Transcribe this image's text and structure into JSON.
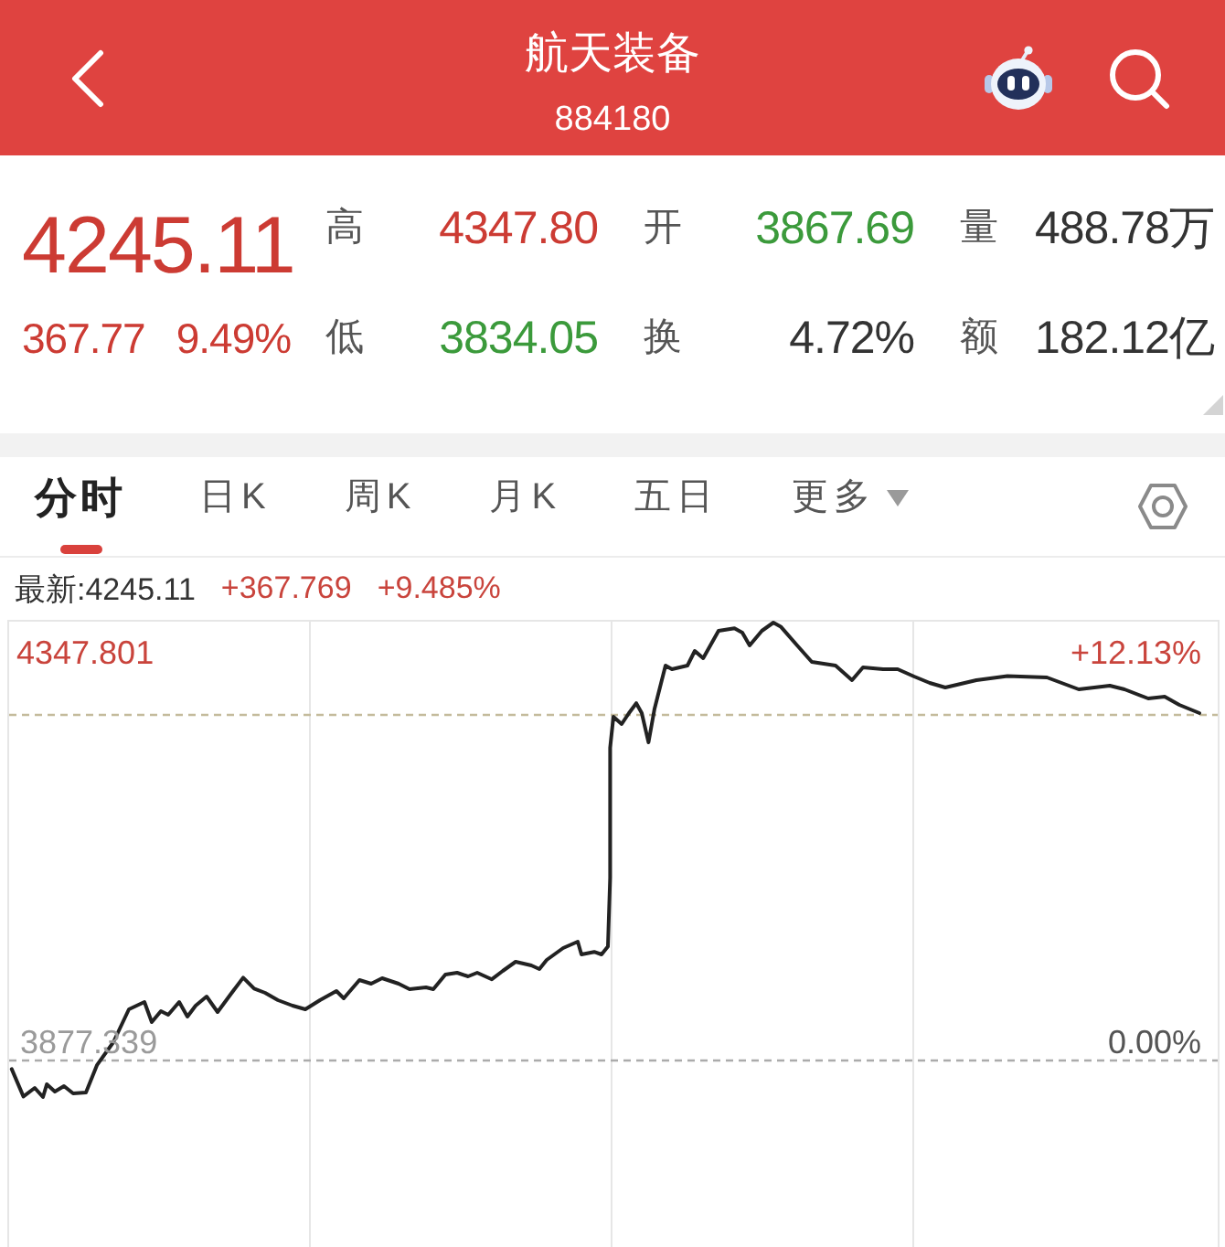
{
  "header": {
    "title": "航天装备",
    "code": "884180"
  },
  "quote": {
    "price": "4245.11",
    "change": "367.77",
    "change_percent": "9.49%",
    "stats": [
      {
        "label": "高",
        "value": "4347.80",
        "color": "#cc3b33"
      },
      {
        "label": "开",
        "value": "3867.69",
        "color": "#3b9a3b"
      },
      {
        "label": "量",
        "value": "488.78万",
        "color": "#333333"
      },
      {
        "label": "低",
        "value": "3834.05",
        "color": "#3b9a3b"
      },
      {
        "label": "换",
        "value": "4.72%",
        "color": "#333333"
      },
      {
        "label": "额",
        "value": "182.12亿",
        "color": "#333333"
      }
    ]
  },
  "tabs": [
    {
      "label": "分时",
      "selected": true,
      "dropdown": false
    },
    {
      "label": "日K",
      "selected": false,
      "dropdown": false
    },
    {
      "label": "周K",
      "selected": false,
      "dropdown": false
    },
    {
      "label": "月K",
      "selected": false,
      "dropdown": false
    },
    {
      "label": "五日",
      "selected": false,
      "dropdown": false
    },
    {
      "label": "更多",
      "selected": false,
      "dropdown": true
    }
  ],
  "latest": {
    "label": "最新:4245.11",
    "change": "+367.769",
    "change_percent": "+9.485%"
  },
  "chart": {
    "top_price": "4347.801",
    "top_percent": "+12.13%",
    "base_price": "3877.339",
    "base_percent": "0.00%"
  }
}
